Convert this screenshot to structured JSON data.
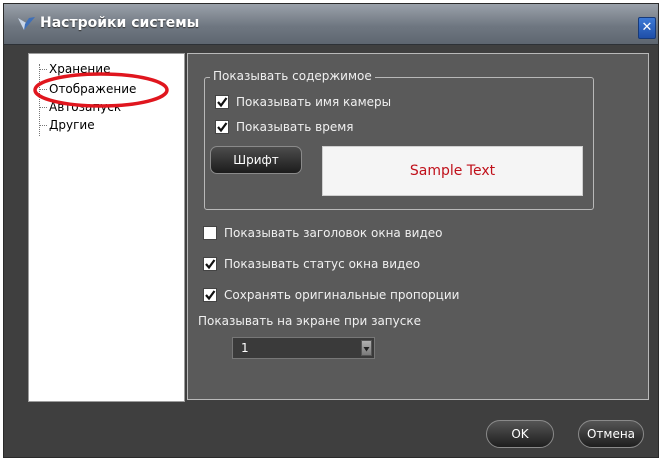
{
  "window": {
    "title": "Настройки системы",
    "close_glyph": "✕",
    "icons": {
      "app": "app-logo-icon",
      "close": "close-icon"
    }
  },
  "tree": {
    "items": [
      {
        "label": "Хранение"
      },
      {
        "label": "Отображение",
        "selected": true
      },
      {
        "label": "Автозапуск"
      },
      {
        "label": "Другие"
      }
    ],
    "highlight_color": "#e0161e"
  },
  "display": {
    "group_title": "Показывать содержимое",
    "show_camera_name": {
      "label": "Показывать имя камеры",
      "checked": true
    },
    "show_time": {
      "label": "Показывать время",
      "checked": true
    },
    "font_button": "Шрифт",
    "sample_text": "Sample Text",
    "sample_text_color": "#c0101a",
    "show_window_title": {
      "label": "Показывать заголовок окна видео",
      "checked": false
    },
    "show_window_status": {
      "label": "Показывать статус окна видео",
      "checked": true
    },
    "keep_proportions": {
      "label": "Сохранять оригинальные пропорции",
      "checked": true
    },
    "startup_screen_label": "Показывать на экране при запуске",
    "startup_screen_value": "1"
  },
  "buttons": {
    "ok": "OK",
    "cancel": "Отмена"
  }
}
